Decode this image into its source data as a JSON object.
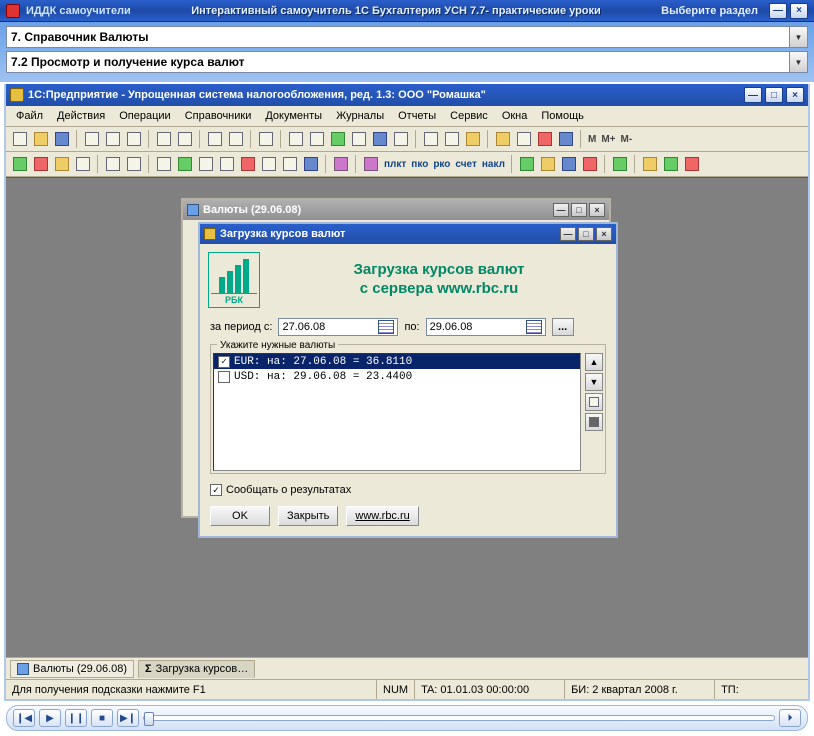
{
  "outer": {
    "brand": "ИДДК самоучители",
    "title": "Интерактивный самоучитель 1С  Бухгалтерия УСН  7.7- практические уроки",
    "prompt": "Выберите раздел"
  },
  "combos": {
    "section": "7. Справочник Валюты",
    "lesson": "7.2 Просмотр и получение курса валют"
  },
  "app": {
    "title": "1С:Предприятие - Упрощенная система налогообложения, ред. 1.3: ООО \"Ромашка\""
  },
  "menu": [
    "Файл",
    "Действия",
    "Операции",
    "Справочники",
    "Документы",
    "Журналы",
    "Отчеты",
    "Сервис",
    "Окна",
    "Помощь"
  ],
  "toolbar_misc": {
    "m": "M",
    "mplus": "M+",
    "mminus": "M-",
    "plkt": "плкт",
    "pko": "пко",
    "rko": "рко",
    "schet": "счет",
    "nakl": "накл"
  },
  "bg_window": {
    "title": "Валюты (29.06.08)"
  },
  "dialog": {
    "title": "Загрузка курсов валют",
    "header1": "Загрузка курсов валют",
    "header2": "с сервера www.rbc.ru",
    "rbc": "РБК",
    "period_lbl": "за период с:",
    "date_from": "27.06.08",
    "to_lbl": "по:",
    "date_to": "29.06.08",
    "ellipsis": "...",
    "fieldset": "Укажите нужные валюты",
    "rows": [
      {
        "checked": true,
        "text": "EUR:    на: 27.06.08 =    36.8110"
      },
      {
        "checked": false,
        "text": "USD:    на: 29.06.08 =    23.4400"
      }
    ],
    "report_checked": true,
    "report_lbl": "Сообщать о результатах",
    "btn_ok": "OK",
    "btn_close": "Закрыть",
    "btn_rbc": "www.rbc.ru"
  },
  "tabs": {
    "tab1": "Валюты (29.06.08)",
    "tab2": "Загрузка курсов…"
  },
  "status": {
    "hint": "Для получения подсказки нажмите F1",
    "num": "NUM",
    "ta": "TA: 01.01.03  00:00:00",
    "bi": "БИ: 2 квартал 2008 г.",
    "tp": "ТП:"
  },
  "glyphs": {
    "min": "—",
    "max": "□",
    "close": "×",
    "check": "✓",
    "prev": "❙◀",
    "play": "▶",
    "pause": "❙❙",
    "stop": "■",
    "next": "▶❙",
    "sigma": "Σ",
    "up": "▲",
    "dn": "▼"
  }
}
